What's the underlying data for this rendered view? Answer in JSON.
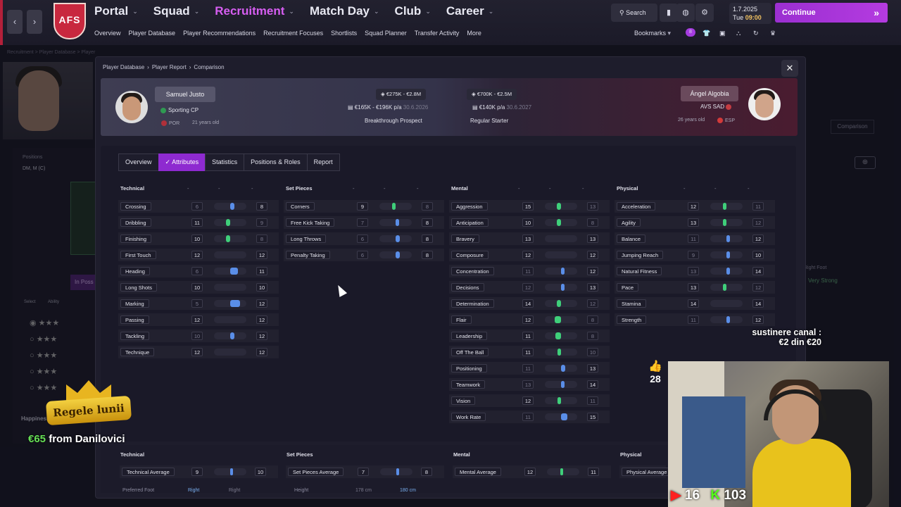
{
  "nav": {
    "logo_text": "AFS",
    "main": [
      "Portal",
      "Squad",
      "Recruitment",
      "Match Day",
      "Club",
      "Career"
    ],
    "active_main": "Recruitment",
    "sub": [
      "Overview",
      "Player Database",
      "Player Recommendations",
      "Recruitment Focuses",
      "Shortlists",
      "Squad Planner",
      "Transfer Activity",
      "More"
    ],
    "search_label": "Search",
    "date": "1.7.2025",
    "day": "Tue",
    "time": "09:00",
    "continue_label": "Continue",
    "bookmarks_label": "Bookmarks",
    "notif_badge": "8"
  },
  "background": {
    "crumb": "Recruitment > Player Database > Player",
    "positions_label": "Positions",
    "positions_value": "DM, M (C)",
    "in_possession": "In Poss",
    "select_label": "Select",
    "ability_label": "Ability",
    "happiness_label": "Happiness",
    "comparison_btn": "Comparison",
    "right_foot": "Right Foot",
    "very_strong": "Very Strong"
  },
  "modal": {
    "breadcrumb": [
      "Player Database",
      "Player Report",
      "Comparison"
    ],
    "close_label": "✕",
    "tabs": [
      "Overview",
      "Attributes",
      "Statistics",
      "Positions & Roles",
      "Report"
    ],
    "active_tab": "Attributes"
  },
  "player_left": {
    "name": "Samuel Justo",
    "club": "Sporting CP",
    "nation": "POR",
    "age": "21 years old",
    "value": "€275K - €2.8M",
    "wage": "€165K - €196K p/a",
    "contract": "30.6.2026",
    "status": "Breakthrough Prospect"
  },
  "player_right": {
    "name": "Ángel Algobia",
    "club": "AVS SAD",
    "nation": "ESP",
    "age": "26 years old",
    "value": "€700K - €2.5M",
    "wage": "€140K p/a",
    "contract": "30.6.2027",
    "status": "Regular Starter"
  },
  "colors": {
    "accent": "#8e2ad0",
    "left_bar": "#5a8ee8",
    "right_bar": "#3fcf7a",
    "header_right": "#4a1c30"
  },
  "groups": [
    {
      "title": "Technical",
      "rows": [
        {
          "name": "Crossing",
          "l": 6,
          "r": 8,
          "better": "right",
          "diff": 2
        },
        {
          "name": "Dribbling",
          "l": 11,
          "r": 9,
          "better": "left",
          "diff": 2
        },
        {
          "name": "Finishing",
          "l": 10,
          "r": 8,
          "better": "left",
          "diff": 2
        },
        {
          "name": "First Touch",
          "l": 12,
          "r": 12,
          "better": "none",
          "diff": 0
        },
        {
          "name": "Heading",
          "l": 6,
          "r": 11,
          "better": "right",
          "diff": 5
        },
        {
          "name": "Long Shots",
          "l": 10,
          "r": 10,
          "better": "none",
          "diff": 0
        },
        {
          "name": "Marking",
          "l": 5,
          "r": 12,
          "better": "right",
          "diff": 7
        },
        {
          "name": "Passing",
          "l": 12,
          "r": 12,
          "better": "none",
          "diff": 0
        },
        {
          "name": "Tackling",
          "l": 10,
          "r": 12,
          "better": "right",
          "diff": 2
        },
        {
          "name": "Technique",
          "l": 12,
          "r": 12,
          "better": "none",
          "diff": 0
        }
      ]
    },
    {
      "title": "Set Pieces",
      "rows": [
        {
          "name": "Corners",
          "l": 9,
          "r": 8,
          "better": "left",
          "diff": 1
        },
        {
          "name": "Free Kick Taking",
          "l": 7,
          "r": 8,
          "better": "right",
          "diff": 1
        },
        {
          "name": "Long Throws",
          "l": 6,
          "r": 8,
          "better": "right",
          "diff": 2
        },
        {
          "name": "Penalty Taking",
          "l": 6,
          "r": 8,
          "better": "right",
          "diff": 2
        }
      ]
    },
    {
      "title": "Mental",
      "rows": [
        {
          "name": "Aggression",
          "l": 15,
          "r": 13,
          "better": "left",
          "diff": 2
        },
        {
          "name": "Anticipation",
          "l": 10,
          "r": 8,
          "better": "left",
          "diff": 2
        },
        {
          "name": "Bravery",
          "l": 13,
          "r": 13,
          "better": "none",
          "diff": 0
        },
        {
          "name": "Composure",
          "l": 12,
          "r": 12,
          "better": "none",
          "diff": 0
        },
        {
          "name": "Concentration",
          "l": 11,
          "r": 12,
          "better": "right",
          "diff": 1
        },
        {
          "name": "Decisions",
          "l": 12,
          "r": 13,
          "better": "right",
          "diff": 1
        },
        {
          "name": "Determination",
          "l": 14,
          "r": 12,
          "better": "left",
          "diff": 2
        },
        {
          "name": "Flair",
          "l": 12,
          "r": 8,
          "better": "left",
          "diff": 4
        },
        {
          "name": "Leadership",
          "l": 11,
          "r": 8,
          "better": "left",
          "diff": 3
        },
        {
          "name": "Off The Ball",
          "l": 11,
          "r": 10,
          "better": "left",
          "diff": 1
        },
        {
          "name": "Positioning",
          "l": 11,
          "r": 13,
          "better": "right",
          "diff": 2
        },
        {
          "name": "Teamwork",
          "l": 13,
          "r": 14,
          "better": "right",
          "diff": 1
        },
        {
          "name": "Vision",
          "l": 12,
          "r": 11,
          "better": "left",
          "diff": 1
        },
        {
          "name": "Work Rate",
          "l": 11,
          "r": 15,
          "better": "right",
          "diff": 4
        }
      ]
    },
    {
      "title": "Physical",
      "rows": [
        {
          "name": "Acceleration",
          "l": 12,
          "r": 11,
          "better": "left",
          "diff": 1
        },
        {
          "name": "Agility",
          "l": 13,
          "r": 12,
          "better": "left",
          "diff": 1
        },
        {
          "name": "Balance",
          "l": 11,
          "r": 12,
          "better": "right",
          "diff": 1
        },
        {
          "name": "Jumping Reach",
          "l": 9,
          "r": 10,
          "better": "right",
          "diff": 1
        },
        {
          "name": "Natural Fitness",
          "l": 13,
          "r": 14,
          "better": "right",
          "diff": 1
        },
        {
          "name": "Pace",
          "l": 13,
          "r": 12,
          "better": "left",
          "diff": 1
        },
        {
          "name": "Stamina",
          "l": 14,
          "r": 14,
          "better": "none",
          "diff": 0
        },
        {
          "name": "Strength",
          "l": 11,
          "r": 12,
          "better": "right",
          "diff": 1
        }
      ]
    }
  ],
  "summary": [
    {
      "title": "Technical",
      "label": "Technical Average",
      "l": 9,
      "r": 10
    },
    {
      "title": "Set Pieces",
      "label": "Set Pieces Average",
      "l": 7,
      "r": 8
    },
    {
      "title": "Mental",
      "label": "Mental Average",
      "l": 12,
      "r": 11
    },
    {
      "title": "Physical",
      "label": "Physical Average",
      "l": "",
      "r": ""
    }
  ],
  "summary_extra": {
    "preferred_foot": "Preferred Foot",
    "left_foot": "Right",
    "right_foot": "Right",
    "height": "Height",
    "left_h": "178 cm",
    "right_h": "180 cm"
  },
  "overlay": {
    "support_line1": "sustinere canal :",
    "support_line2": "€2 din €20",
    "likes": "28",
    "yt_count": "16",
    "kick_count": "103",
    "crown_text": "Regele lunii",
    "donor_amount": "€65",
    "donor_text": "from Danilovici"
  }
}
